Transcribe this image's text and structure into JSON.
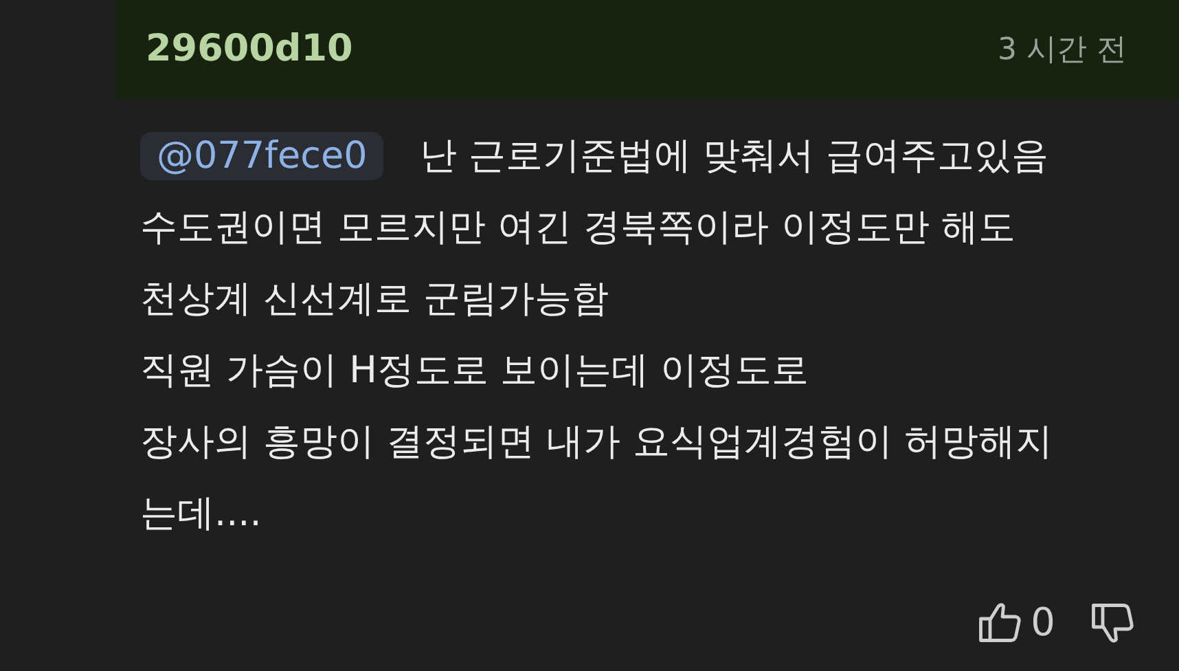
{
  "comment": {
    "author": "29600d10",
    "time": "3 시간 전",
    "mention": "@077fece0",
    "lines": [
      "난 근로기준법에 맞춰서 급여주고있음",
      "수도권이면 모르지만 여긴 경북쪽이라 이정도만 해도",
      "천상계 신선계로 군림가능함",
      "직원 가슴이 H정도로 보이는데 이정도로",
      "장사의 흥망이 결정되면 내가 요식업계경험이 허망해지",
      "는데...."
    ],
    "likes": "0"
  }
}
